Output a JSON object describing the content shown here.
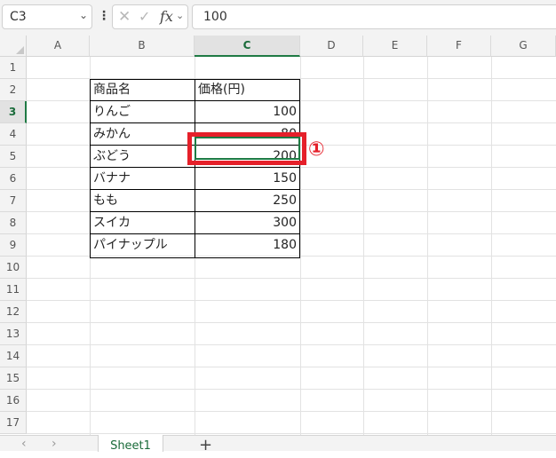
{
  "formula_bar": {
    "name_box": "C3",
    "cancel_icon": "✕",
    "enter_icon": "✓",
    "fx_label": "fx",
    "formula_value": "100"
  },
  "columns": [
    "A",
    "B",
    "C",
    "D",
    "E",
    "F",
    "G"
  ],
  "rows": [
    "1",
    "2",
    "3",
    "4",
    "5",
    "6",
    "7",
    "8",
    "9",
    "10",
    "11",
    "12",
    "13",
    "14",
    "15",
    "16",
    "17"
  ],
  "selected_column": "C",
  "selected_row": "3",
  "table": {
    "header": [
      "商品名",
      "価格(円)"
    ],
    "rows": [
      [
        "りんご",
        "100"
      ],
      [
        "みかん",
        "80"
      ],
      [
        "ぶどう",
        "200"
      ],
      [
        "バナナ",
        "150"
      ],
      [
        "もも",
        "250"
      ],
      [
        "スイカ",
        "300"
      ],
      [
        "パイナップル",
        "180"
      ]
    ]
  },
  "annotation": {
    "marker": "①",
    "color": "#e5202a"
  },
  "sheet_tabs": {
    "active": "Sheet1",
    "add_label": "+"
  },
  "colors": {
    "accent": "#1f7a44",
    "highlight": "#e5202a"
  }
}
